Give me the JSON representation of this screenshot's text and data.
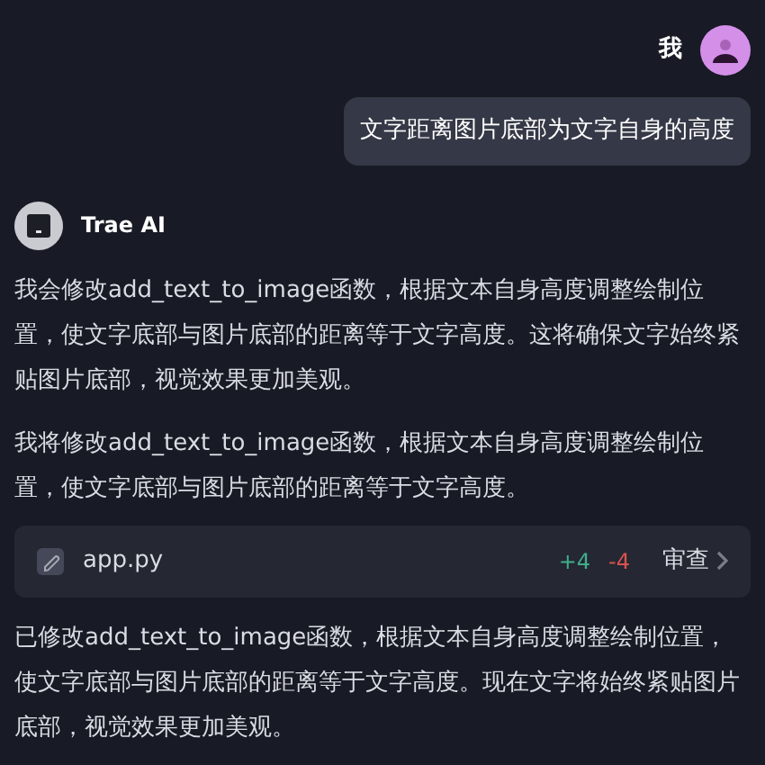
{
  "user": {
    "name": "我",
    "message": "文字距离图片底部为文字自身的高度"
  },
  "assistant": {
    "name": "Trae AI",
    "paragraphs": [
      "我会修改add_text_to_image函数，根据文本自身高度调整绘制位置，使文字底部与图片底部的距离等于文字高度。这将确保文字始终紧贴图片底部，视觉效果更加美观。",
      "我将修改add_text_to_image函数，根据文本自身高度调整绘制位置，使文字底部与图片底部的距离等于文字高度。"
    ],
    "file_change": {
      "filename": "app.py",
      "added": "+4",
      "removed": "-4",
      "action": "审查"
    },
    "summary": "已修改add_text_to_image函数，根据文本自身高度调整绘制位置，使文字底部与图片底部的距离等于文字高度。现在文字将始终紧贴图片底部，视觉效果更加美观。"
  }
}
